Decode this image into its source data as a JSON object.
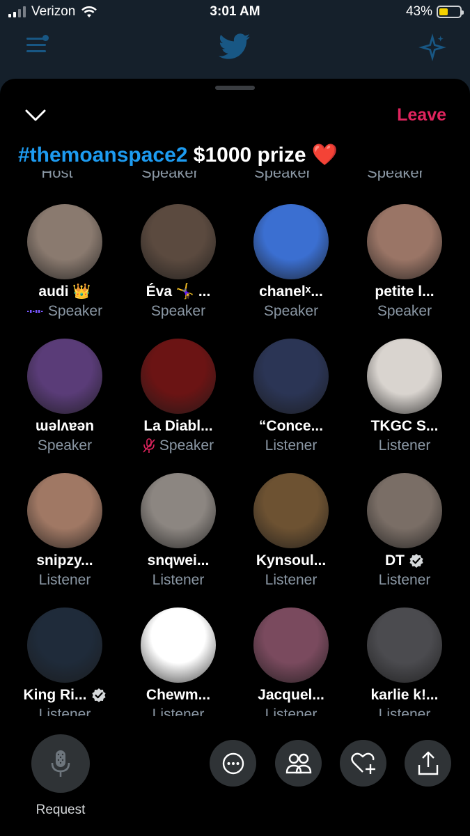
{
  "status_bar": {
    "carrier": "Verizon",
    "time": "3:01 AM",
    "battery": "43%",
    "battery_level": 0.43
  },
  "space": {
    "leave_label": "Leave",
    "title_hashtag": "#themoanspace2",
    "title_rest": "$1000 prize",
    "title_emoji": "❤️"
  },
  "cut_off_roles": [
    "Host",
    "Speaker",
    "Speaker",
    "Speaker"
  ],
  "participants": [
    {
      "name": "audi 👑",
      "role": "Speaker",
      "speaking": true,
      "muted": false,
      "verified": false,
      "avatar_color": "#8a7a6f"
    },
    {
      "name": "Éva 🤸‍♀️ ...",
      "role": "Speaker",
      "speaking": false,
      "muted": false,
      "verified": false,
      "avatar_color": "#5b4a3f"
    },
    {
      "name": "chanelˣ...",
      "role": "Speaker",
      "speaking": false,
      "muted": false,
      "verified": false,
      "avatar_color": "#3b6fd1"
    },
    {
      "name": "petite l...",
      "role": "Speaker",
      "speaking": false,
      "muted": false,
      "verified": false,
      "avatar_color": "#9a7566"
    },
    {
      "name": "ɯǝlʌɐǝn",
      "role": "Speaker",
      "speaking": false,
      "muted": false,
      "verified": false,
      "avatar_color": "#5a3c78"
    },
    {
      "name": "La Diabl...",
      "role": "Speaker",
      "speaking": false,
      "muted": true,
      "verified": false,
      "avatar_color": "#6b1414"
    },
    {
      "name": "“Conce...",
      "role": "Listener",
      "speaking": false,
      "muted": false,
      "verified": false,
      "avatar_color": "#2b3555"
    },
    {
      "name": "TKGC S...",
      "role": "Listener",
      "speaking": false,
      "muted": false,
      "verified": false,
      "avatar_color": "#d9d4cf"
    },
    {
      "name": "snipzy...",
      "role": "Listener",
      "speaking": false,
      "muted": false,
      "verified": false,
      "avatar_color": "#a07864"
    },
    {
      "name": "snqwei...",
      "role": "Listener",
      "speaking": false,
      "muted": false,
      "verified": false,
      "avatar_color": "#8c8681"
    },
    {
      "name": "Kynsoul...",
      "role": "Listener",
      "speaking": false,
      "muted": false,
      "verified": false,
      "avatar_color": "#6d5232"
    },
    {
      "name": "DT",
      "role": "Listener",
      "speaking": false,
      "muted": false,
      "verified": true,
      "avatar_color": "#7a6e66"
    },
    {
      "name": "King Ri...",
      "role": "Listener",
      "speaking": false,
      "muted": false,
      "verified": true,
      "avatar_color": "#1f2b3a"
    },
    {
      "name": "Chewm...",
      "role": "Listener",
      "speaking": false,
      "muted": false,
      "verified": false,
      "avatar_color": "#ffffff"
    },
    {
      "name": "Jacquel...",
      "role": "Listener",
      "speaking": false,
      "muted": false,
      "verified": false,
      "avatar_color": "#7a4a5e"
    },
    {
      "name": "karlie k!...",
      "role": "Listener",
      "speaking": false,
      "muted": false,
      "verified": false,
      "avatar_color": "#4b4b4f"
    }
  ],
  "bottom_bar": {
    "request_label": "Request",
    "icons": [
      "more-icon",
      "people-icon",
      "heart-plus-icon",
      "share-icon"
    ]
  },
  "colors": {
    "accent": "#1d9bf0",
    "leave": "#e0245e",
    "secondary_text": "#8b98a5",
    "button_bg": "#2f3336"
  }
}
